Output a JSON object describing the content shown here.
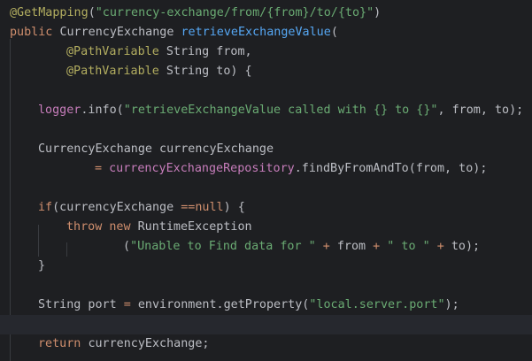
{
  "editor": {
    "lines": [
      {
        "tokens": [
          {
            "t": "@GetMapping",
            "c": "ann"
          },
          {
            "t": "(",
            "c": "pl"
          },
          {
            "t": "\"currency-exchange/from/{from}/to/{to}\"",
            "c": "str"
          },
          {
            "t": ")",
            "c": "pl"
          }
        ]
      },
      {
        "tokens": [
          {
            "t": "public ",
            "c": "kw"
          },
          {
            "t": "CurrencyExchange ",
            "c": "pl"
          },
          {
            "t": "retrieveExchangeValue",
            "c": "fn"
          },
          {
            "t": "(",
            "c": "pl"
          }
        ]
      },
      {
        "indent": 8,
        "tokens": [
          {
            "t": "@PathVariable ",
            "c": "ann"
          },
          {
            "t": "String from,",
            "c": "pl"
          }
        ]
      },
      {
        "indent": 8,
        "tokens": [
          {
            "t": "@PathVariable ",
            "c": "ann"
          },
          {
            "t": "String to) {",
            "c": "pl"
          }
        ]
      },
      {
        "tokens": []
      },
      {
        "indent": 4,
        "tokens": [
          {
            "t": "logger",
            "c": "fld"
          },
          {
            "t": ".info(",
            "c": "pl"
          },
          {
            "t": "\"retrieveExchangeValue called with {} to {}\"",
            "c": "str"
          },
          {
            "t": ", from, to);",
            "c": "pl"
          }
        ]
      },
      {
        "tokens": []
      },
      {
        "indent": 4,
        "tokens": [
          {
            "t": "CurrencyExchange currencyExchange",
            "c": "pl"
          }
        ]
      },
      {
        "indent": 12,
        "tokens": [
          {
            "t": "= ",
            "c": "kw"
          },
          {
            "t": "currencyExchangeRepository",
            "c": "fld"
          },
          {
            "t": ".findByFromAndTo(from, to);",
            "c": "pl"
          }
        ]
      },
      {
        "tokens": []
      },
      {
        "indent": 4,
        "tokens": [
          {
            "t": "if",
            "c": "kw"
          },
          {
            "t": "(currencyExchange ",
            "c": "pl"
          },
          {
            "t": "==",
            "c": "kw"
          },
          {
            "t": "null",
            "c": "kw"
          },
          {
            "t": ") {",
            "c": "pl"
          }
        ]
      },
      {
        "indent": 8,
        "tokens": [
          {
            "t": "throw new ",
            "c": "kw"
          },
          {
            "t": "RuntimeException",
            "c": "pl"
          }
        ]
      },
      {
        "indent": 16,
        "tokens": [
          {
            "t": "(",
            "c": "pl"
          },
          {
            "t": "\"Unable to Find data for \"",
            "c": "str"
          },
          {
            "t": " + ",
            "c": "kw"
          },
          {
            "t": "from",
            "c": "pl"
          },
          {
            "t": " + ",
            "c": "kw"
          },
          {
            "t": "\" to \"",
            "c": "str"
          },
          {
            "t": " + ",
            "c": "kw"
          },
          {
            "t": "to);",
            "c": "pl"
          }
        ]
      },
      {
        "indent": 4,
        "tokens": [
          {
            "t": "}",
            "c": "pl"
          }
        ]
      },
      {
        "tokens": []
      },
      {
        "indent": 4,
        "tokens": [
          {
            "t": "String port ",
            "c": "pl"
          },
          {
            "t": "=",
            "c": "kw"
          },
          {
            "t": " environment.getProperty(",
            "c": "pl"
          },
          {
            "t": "\"local.server.port\"",
            "c": "str"
          },
          {
            "t": ");",
            "c": "pl"
          }
        ]
      },
      {
        "tokens": []
      },
      {
        "indent": 4,
        "tokens": [
          {
            "t": "return ",
            "c": "kw"
          },
          {
            "t": "currencyExchange;",
            "c": "pl"
          }
        ]
      }
    ],
    "colors": {
      "background": "#1e1f22",
      "caret_line": "#26282e",
      "indent_guide": "#393b40",
      "annotation": "#b3ae60",
      "keyword": "#cf8e6d",
      "string": "#6aab73",
      "method_declaration": "#56a8f5",
      "field": "#c77dbb",
      "plain": "#bcbec4"
    }
  }
}
